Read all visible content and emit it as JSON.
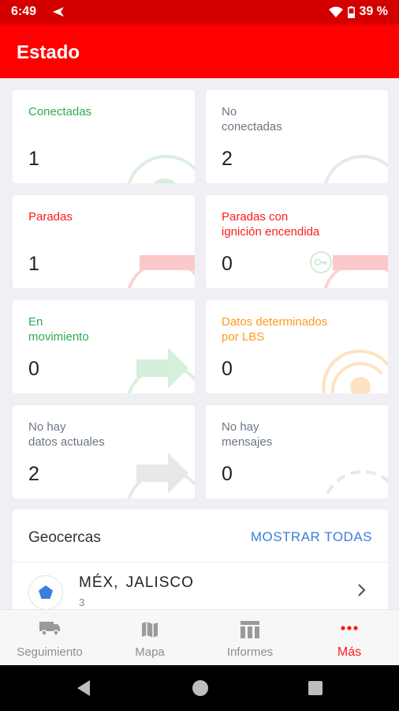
{
  "status_bar": {
    "time": "6:49",
    "battery": "39 %"
  },
  "app_bar": {
    "title": "Estado"
  },
  "cards": {
    "connected": {
      "label": "Conectadas",
      "count": "1"
    },
    "not_connected": {
      "label": "No\nconectadas",
      "count": "2"
    },
    "stopped": {
      "label": "Paradas",
      "count": "1"
    },
    "stopped_ignition": {
      "label": "Paradas con\nignición encendida",
      "count": "0"
    },
    "moving": {
      "label": "En\nmovimiento",
      "count": "0"
    },
    "lbs": {
      "label": "Datos determinados\npor LBS",
      "count": "0"
    },
    "no_data": {
      "label": "No hay\ndatos actuales",
      "count": "2"
    },
    "no_messages": {
      "label": "No hay\nmensajes",
      "count": "0"
    }
  },
  "colors": {
    "green": "#2eaa55",
    "gray": "#6b7785",
    "red": "#ff1a1a",
    "orange": "#ff9a1f",
    "blue": "#3b7ddd"
  },
  "geofences": {
    "title": "Geocercas",
    "show_all": "MOSTRAR TODAS",
    "items": [
      {
        "name": "MÉX, JALISCO",
        "count": "3",
        "icon": "pentagon-icon"
      }
    ]
  },
  "bottom_nav": [
    {
      "label": "Seguimiento",
      "icon": "truck-icon"
    },
    {
      "label": "Mapa",
      "icon": "map-icon"
    },
    {
      "label": "Informes",
      "icon": "reports-icon"
    },
    {
      "label": "Más",
      "icon": "more-dots-icon",
      "active": true
    }
  ]
}
